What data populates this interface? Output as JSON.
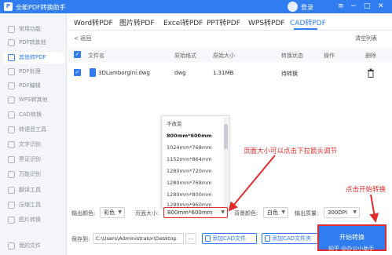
{
  "app": {
    "title": "全能PDF转换助手",
    "login": "登录",
    "window_controls": [
      "≡",
      "−",
      "□",
      "✕"
    ]
  },
  "sidebar": {
    "items": [
      {
        "label": "常用功能",
        "active": false
      },
      {
        "label": "PDF转其他",
        "active": false
      },
      {
        "label": "其他转PDF",
        "active": true
      },
      {
        "label": "PDF处理",
        "active": false
      },
      {
        "label": "PDF编辑",
        "active": false
      },
      {
        "label": "WPS转其他",
        "active": false
      },
      {
        "label": "CAD转换",
        "active": false
      },
      {
        "label": "转语音工具",
        "active": false
      },
      {
        "label": "文字识别",
        "active": false
      },
      {
        "label": "票证识别",
        "active": false
      },
      {
        "label": "万能识别",
        "active": false
      },
      {
        "label": "翻译工具",
        "active": false
      },
      {
        "label": "压缩工具",
        "active": false
      },
      {
        "label": "图片转换",
        "active": false
      },
      {
        "label": "我的文件",
        "active": false
      }
    ]
  },
  "tabs": [
    {
      "label": "Word转PDF"
    },
    {
      "label": "图片转PDF"
    },
    {
      "label": "Excel转PDF"
    },
    {
      "label": "PPT转PDF"
    },
    {
      "label": "WPS转PDF"
    },
    {
      "label": "CAD转PDF",
      "active": true
    }
  ],
  "subbar": {
    "back": "< 返回",
    "clear": "清空列表"
  },
  "table": {
    "headers": {
      "name": "文件名",
      "orig_format": "原始格式",
      "orig_size": "原始大小",
      "status": "转换状态",
      "action": "操作",
      "delete": "删除"
    },
    "rows": [
      {
        "name": "3DLamborgini.dwg",
        "format": "dwg",
        "size": "1.31MB",
        "status": "待转换"
      }
    ]
  },
  "dropdown": {
    "options": [
      "不改变",
      "800mm*600mm",
      "1024mm*768mm",
      "1152mm*864mm",
      "1280mm*720mm",
      "1280mm*768mm",
      "1280mm*800mm",
      "1280mm*960mm"
    ],
    "selected": "800mm*600mm"
  },
  "annotations": {
    "page_size_note": "页面大小可以点击下拉箭头调节",
    "start_note": "点击开始转换"
  },
  "options": {
    "output_color_label": "输出颜色:",
    "output_color_value": "彩色",
    "page_size_label": "页面大小:",
    "page_size_value": "800mm*600mm",
    "bg_color_label": "背景颜色:",
    "bg_color_value": "白色",
    "output_quality_label": "输出质量:",
    "output_quality_value": "300DPI"
  },
  "save": {
    "label": "保存到:",
    "path": "C:\\Users\\Administrator\\Desktop",
    "browse": "...",
    "add_file": "添加CAD文件",
    "add_folder": "添加CAD文件夹",
    "start": "开始转换"
  },
  "watermark": "知乎 @办公小助手",
  "colors": {
    "accent": "#2f7df0",
    "annotation": "#e22b2b"
  }
}
